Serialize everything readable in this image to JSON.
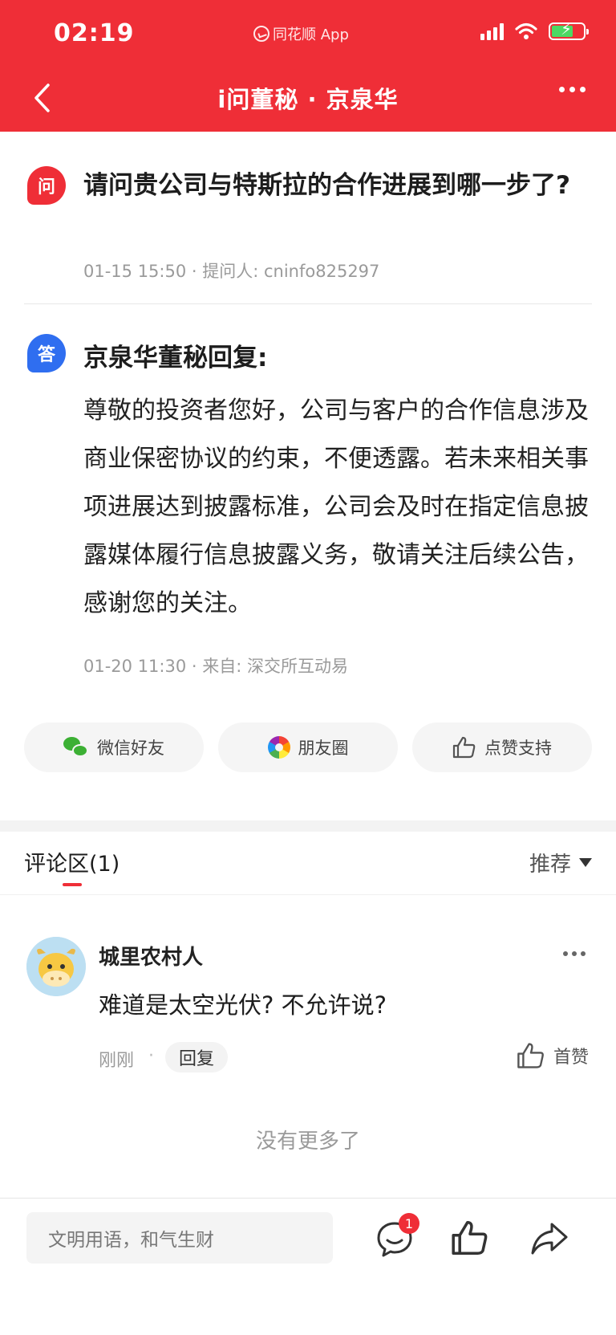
{
  "status": {
    "time": "02:19",
    "app_name": "同花顺 App"
  },
  "nav": {
    "title": "i问董秘 · 京泉华"
  },
  "question": {
    "badge": "问",
    "text": "请问贵公司与特斯拉的合作进展到哪一步了?",
    "meta": "01-15 15:50 · 提问人: cninfo825297"
  },
  "answer": {
    "badge": "答",
    "title": "京泉华董秘回复:",
    "text": "尊敬的投资者您好，公司与客户的合作信息涉及商业保密协议的约束，不便透露。若未来相关事项进展达到披露标准，公司会及时在指定信息披露媒体履行信息披露义务，敬请关注后续公告，感谢您的关注。",
    "meta": "01-20 11:30 · 来自: 深交所互动易"
  },
  "share": {
    "wechat_label": "微信好友",
    "moments_label": "朋友圈",
    "like_label": "点赞支持"
  },
  "comments": {
    "title": "评论区(1)",
    "sort_label": "推荐",
    "items": [
      {
        "user": "城里农村人",
        "text": "难道是太空光伏? 不允许说?",
        "time": "刚刚",
        "reply_label": "回复",
        "like_label": "首赞"
      }
    ],
    "end_text": "没有更多了"
  },
  "bottom": {
    "input_placeholder": "文明用语，和气生财",
    "comment_count": "1"
  },
  "colors": {
    "brand_red": "#ef2e37",
    "answer_blue": "#2f6ef0"
  }
}
